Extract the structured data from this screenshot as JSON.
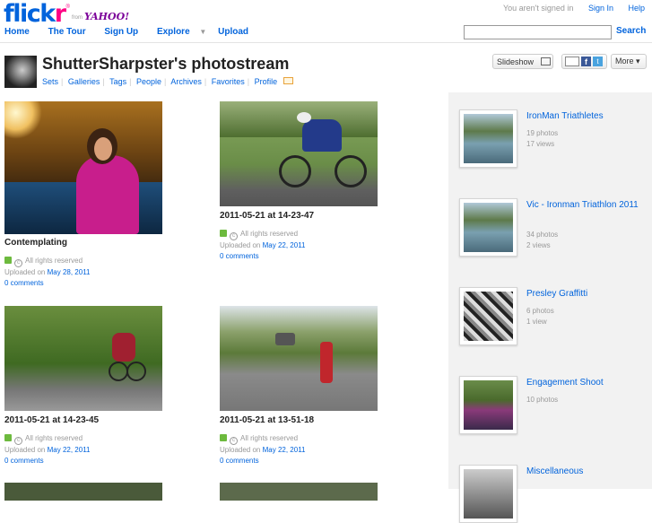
{
  "header": {
    "logo": {
      "flickr_text": "flickr",
      "registered": "®",
      "from": "from",
      "yahoo": "YAHOO!"
    },
    "signed_out_text": "You aren't signed in",
    "sign_in": "Sign In",
    "help": "Help",
    "nav": [
      "Home",
      "The Tour",
      "Sign Up",
      "Explore",
      "Upload"
    ],
    "search_value": "",
    "search_label": "Search"
  },
  "profile": {
    "title": "ShutterSharpster's photostream",
    "subnav": [
      "Sets",
      "Galleries",
      "Tags",
      "People",
      "Archives",
      "Favorites",
      "Profile"
    ],
    "slideshow": "Slideshow",
    "more": "More ▾"
  },
  "photos": [
    {
      "title": "Contemplating",
      "license": "All rights reserved",
      "uploaded_prefix": "Uploaded on",
      "uploaded_date": "May 28, 2011",
      "comments": "0 comments"
    },
    {
      "title": "2011-05-21 at 14-23-47",
      "license": "All rights reserved",
      "uploaded_prefix": "Uploaded on",
      "uploaded_date": "May 22, 2011",
      "comments": "0 comments"
    },
    {
      "title": "2011-05-21 at 14-23-45",
      "license": "All rights reserved",
      "uploaded_prefix": "Uploaded on",
      "uploaded_date": "May 22, 2011",
      "comments": "0 comments"
    },
    {
      "title": "2011-05-21 at 13-51-18",
      "license": "All rights reserved",
      "uploaded_prefix": "Uploaded on",
      "uploaded_date": "May 22, 2011",
      "comments": "0 comments"
    }
  ],
  "sets": [
    {
      "title": "IronMan Triathletes",
      "photos": "19 photos",
      "views": "17 views"
    },
    {
      "title": "Vic - Ironman Triathlon 2011",
      "photos": "34 photos",
      "views": "2 views"
    },
    {
      "title": "Presley Graffitti",
      "photos": "6 photos",
      "views": "1 view"
    },
    {
      "title": "Engagement Shoot",
      "photos": "10 photos",
      "views": ""
    },
    {
      "title": "Miscellaneous",
      "photos": "",
      "views": ""
    }
  ],
  "icons": {
    "facebook": "f",
    "twitter": "t"
  }
}
